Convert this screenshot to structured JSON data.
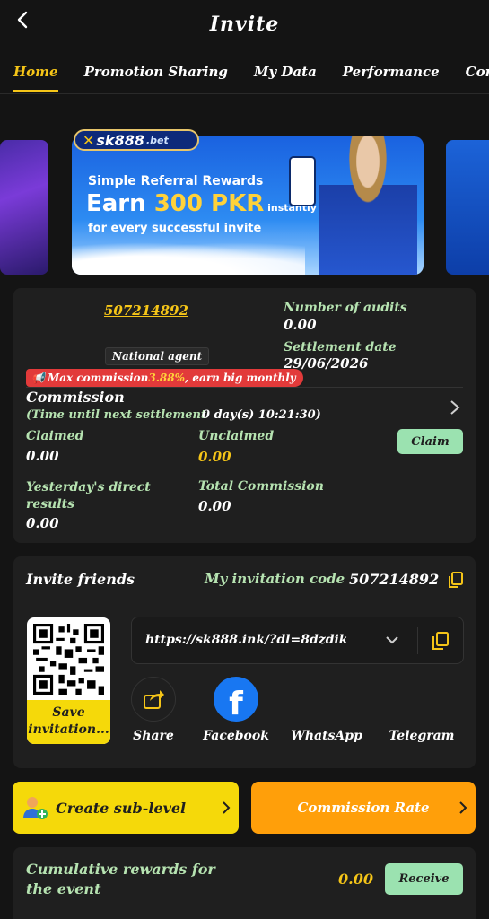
{
  "header": {
    "title": "Invite"
  },
  "tabs": [
    {
      "label": "Home"
    },
    {
      "label": "Promotion Sharing"
    },
    {
      "label": "My Data"
    },
    {
      "label": "Performance"
    },
    {
      "label": "Commiss"
    }
  ],
  "banner": {
    "logo": "sk888",
    "logo_suffix": ".bet",
    "line1": "Simple Referral Rewards",
    "line2_prefix": "Earn ",
    "line2_highlight": "300 PKR",
    "line2_suffix": " instantly",
    "line3": "for every successful invite"
  },
  "account": {
    "uid": "507214892",
    "badge": "National agent",
    "audits_label": "Number of audits",
    "audits_value": "0.00",
    "settlement_label": "Settlement date",
    "settlement_value": "29/06/2026",
    "max_commission_prefix": "Max commission ",
    "max_commission_value": "3.88%",
    "max_commission_suffix": ", earn big monthly"
  },
  "commission": {
    "title": "Commission",
    "countdown_label": "(Time until next settlement",
    "countdown_value": "0 day(s) 10:21:30)",
    "claimed_label": "Claimed",
    "claimed_value": "0.00",
    "unclaimed_label": "Unclaimed",
    "unclaimed_value": "0.00",
    "claim_button": "Claim",
    "yesterday_label": "Yesterday's direct results",
    "yesterday_value": "0.00",
    "total_label": "Total Commission",
    "total_value": "0.00"
  },
  "invite": {
    "title": "Invite friends",
    "code_label": "My invitation code",
    "code_value": "507214892",
    "link": "https://sk888.ink/?dl=8dzdik",
    "qr_save": "Save invitation...",
    "share_items": [
      {
        "label": "Share"
      },
      {
        "label": "Facebook"
      },
      {
        "label": "WhatsApp"
      },
      {
        "label": "Telegram"
      }
    ]
  },
  "actions": {
    "create_sublevel": "Create sub-level",
    "commission_rate": "Commission Rate"
  },
  "event": {
    "title": "Cumulative rewards for the event",
    "value": "0.00",
    "receive_button": "Receive"
  },
  "colors": {
    "accent": "#f5c518",
    "label_green": "#b6e3b1",
    "button_green": "#9be2b0",
    "create_yellow": "#f5d90a",
    "rate_orange": "#ff9f0a"
  }
}
